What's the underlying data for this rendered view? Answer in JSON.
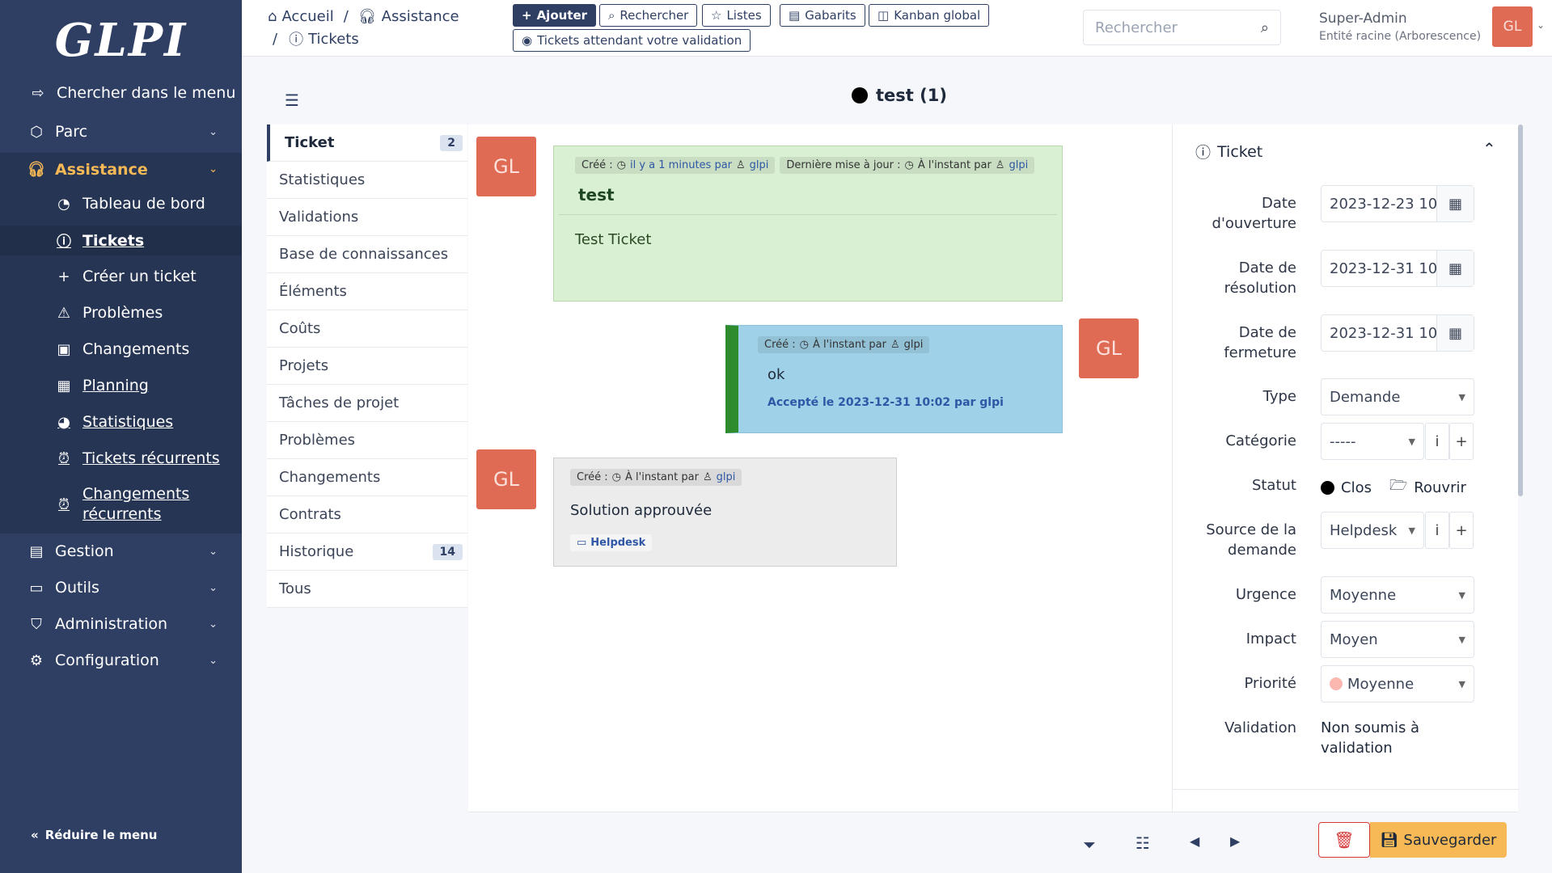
{
  "app": {
    "logo": "GLPI"
  },
  "sidebar": {
    "search_menu": "Chercher dans le menu",
    "items": [
      {
        "label": "Parc"
      },
      {
        "label": "Assistance"
      },
      {
        "label": "Gestion"
      },
      {
        "label": "Outils"
      },
      {
        "label": "Administration"
      },
      {
        "label": "Configuration"
      }
    ],
    "assistance_sub": [
      {
        "label": "Tableau de bord"
      },
      {
        "label": "Tickets"
      },
      {
        "label": "Créer un ticket"
      },
      {
        "label": "Problèmes"
      },
      {
        "label": "Changements"
      },
      {
        "label": "Planning"
      },
      {
        "label": "Statistiques"
      },
      {
        "label": "Tickets récurrents"
      },
      {
        "label": "Changements récurrents"
      }
    ],
    "reduce": "Réduire le menu"
  },
  "breadcrumb": {
    "home": "Accueil",
    "sep": "/",
    "section": "Assistance",
    "page": "Tickets"
  },
  "toolbar": {
    "add": "Ajouter",
    "search": "Rechercher",
    "lists": "Listes",
    "templates": "Gabarits",
    "kanban": "Kanban global",
    "waiting": "Tickets attendant votre validation"
  },
  "search": {
    "placeholder": "Rechercher"
  },
  "user": {
    "name": "Super-Admin",
    "entity": "Entité racine (Arborescence)",
    "initials": "GL"
  },
  "ticket": {
    "title": "test (1)"
  },
  "tabs": [
    {
      "label": "Ticket",
      "badge": "2"
    },
    {
      "label": "Statistiques"
    },
    {
      "label": "Validations"
    },
    {
      "label": "Base de connaissances"
    },
    {
      "label": "Éléments"
    },
    {
      "label": "Coûts"
    },
    {
      "label": "Projets"
    },
    {
      "label": "Tâches de projet"
    },
    {
      "label": "Problèmes"
    },
    {
      "label": "Changements"
    },
    {
      "label": "Contrats"
    },
    {
      "label": "Historique",
      "badge": "14"
    },
    {
      "label": "Tous"
    }
  ],
  "timeline": {
    "entry1": {
      "initials": "GL",
      "created_label": "Créé :",
      "created_time": "il y a 1 minutes par",
      "author": "glpi",
      "updated_label": "Dernière mise à jour :",
      "updated_time": "À l'instant par",
      "updated_author": "glpi",
      "title": "test",
      "content": "Test Ticket"
    },
    "entry2": {
      "initials": "GL",
      "created_label": "Créé :",
      "created_time": "À l'instant par",
      "author": "glpi",
      "content": "ok",
      "accepted": "Accepté le 2023-12-31 10:02 par glpi"
    },
    "entry3": {
      "initials": "GL",
      "created_label": "Créé :",
      "created_time": "À l'instant par",
      "author": "glpi",
      "content": "Solution approuvée",
      "source": "Helpdesk"
    }
  },
  "panel": {
    "title": "Ticket",
    "fields": {
      "open_date_label": "Date d'ouverture",
      "open_date": "2023-12-23 10",
      "resolve_date_label": "Date de résolution",
      "resolve_date": "2023-12-31 10",
      "close_date_label": "Date de fermeture",
      "close_date": "2023-12-31 10",
      "type_label": "Type",
      "type": "Demande",
      "category_label": "Catégorie",
      "category": "-----",
      "status_label": "Statut",
      "status": "Clos",
      "reopen": "Rouvrir",
      "source_label": "Source de la demande",
      "source": "Helpdesk",
      "urgency_label": "Urgence",
      "urgency": "Moyenne",
      "impact_label": "Impact",
      "impact": "Moyen",
      "priority_label": "Priorité",
      "priority": "Moyenne",
      "validation_label": "Validation",
      "validation": "Non soumis à validation"
    }
  },
  "footer": {
    "save": "Sauvegarder"
  },
  "colors": {
    "sidebar": "#2f3f64",
    "accent": "#f7b955",
    "avatar": "#e06b55",
    "followup": "#9fd1e8",
    "ticket": "#d9f0d3",
    "solution": "#ececec"
  }
}
